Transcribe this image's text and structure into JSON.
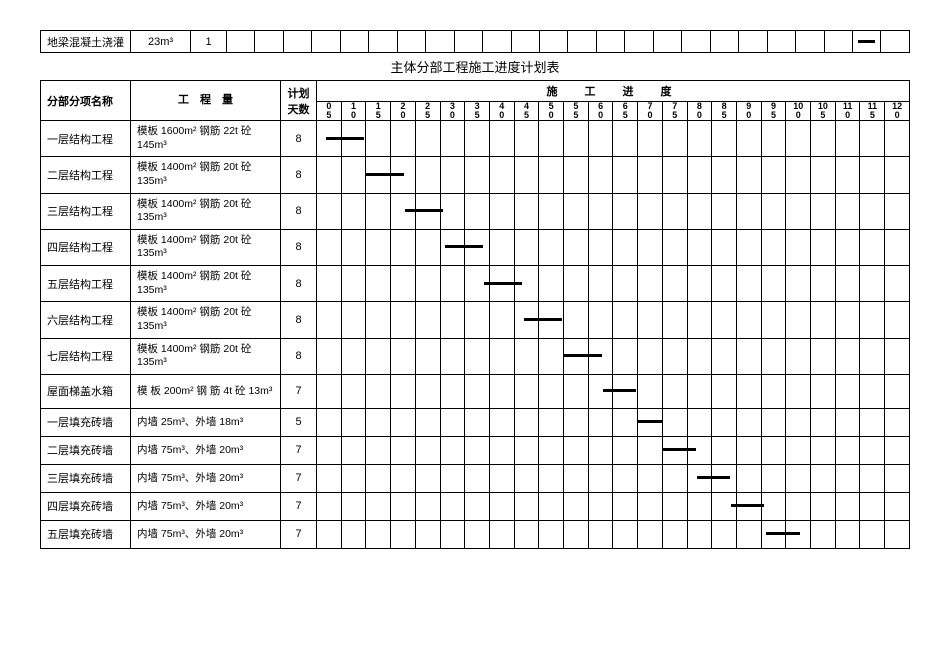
{
  "top_table": {
    "label": "地梁混凝土浇灌",
    "qty": "23m³",
    "days": "1",
    "bar_cell": 22
  },
  "caption": "主体分部工程施工进度计划表",
  "headers": {
    "name": "分部分项名称",
    "qty": "工　程　量",
    "days": "计划天数",
    "sched_group": "施　工　进　度"
  },
  "ticks": [
    "0 5",
    "1 0",
    "1 5",
    "2 0",
    "2 5",
    "3 0",
    "3 5",
    "4 0",
    "4 5",
    "5 0",
    "5 5",
    "6 0",
    "6 5",
    "7 0",
    "7 5",
    "8 0",
    "8 5",
    "9 0",
    "9 5",
    "10 0",
    "10 5",
    "11 0",
    "11 5",
    "12 0"
  ],
  "rows": [
    {
      "name": "一层结构工程",
      "qty": "模板 1600m² 钢筋 22t 砼 145m³",
      "days": "8",
      "tall": true
    },
    {
      "name": "二层结构工程",
      "qty": "模板 1400m² 钢筋 20t 砼 135m³",
      "days": "8",
      "tall": true
    },
    {
      "name": "三层结构工程",
      "qty": "模板 1400m² 钢筋 20t 砼 135m³",
      "days": "8",
      "tall": true
    },
    {
      "name": "四层结构工程",
      "qty": "模板 1400m² 钢筋 20t 砼 135m³",
      "days": "8",
      "tall": true
    },
    {
      "name": "五层结构工程",
      "qty": "模板 1400m² 钢筋 20t 砼 135m³",
      "days": "8",
      "tall": true
    },
    {
      "name": "六层结构工程",
      "qty": "模板 1400m² 钢筋 20t 砼 135m³",
      "days": "8",
      "tall": true
    },
    {
      "name": "七层结构工程",
      "qty": "模板 1400m² 钢筋 20t 砼 135m³",
      "days": "8",
      "tall": true
    },
    {
      "name": "屋面梯盖水箱",
      "qty": "模 板 200m² 钢 筋 4t 砼 13m³",
      "days": "7",
      "tall": true
    },
    {
      "name": "一层填充砖墙",
      "qty": "内墙 25m³、外墙 18m³",
      "days": "5",
      "tall": false
    },
    {
      "name": "二层填充砖墙",
      "qty": "内墙 75m³、外墙 20m³",
      "days": "7",
      "tall": false
    },
    {
      "name": "三层填充砖墙",
      "qty": "内墙 75m³、外墙 20m³",
      "days": "7",
      "tall": false
    },
    {
      "name": "四层填充砖墙",
      "qty": "内墙 75m³、外墙 20m³",
      "days": "7",
      "tall": false
    },
    {
      "name": "五层填充砖墙",
      "qty": "内墙 75m³、外墙 20m³",
      "days": "7",
      "tall": false
    }
  ],
  "chart_data": {
    "type": "bar",
    "title": "主体分部工程施工进度计划表 (Gantt)",
    "xlabel": "施工进度 (天)",
    "ylabel": "分部分项名称",
    "xlim": [
      0,
      120
    ],
    "series": [
      {
        "name": "一层结构工程",
        "start": 2,
        "end": 10,
        "duration": 8
      },
      {
        "name": "二层结构工程",
        "start": 10,
        "end": 18,
        "duration": 8
      },
      {
        "name": "三层结构工程",
        "start": 18,
        "end": 26,
        "duration": 8
      },
      {
        "name": "四层结构工程",
        "start": 26,
        "end": 34,
        "duration": 8
      },
      {
        "name": "五层结构工程",
        "start": 34,
        "end": 42,
        "duration": 8
      },
      {
        "name": "六层结构工程",
        "start": 42,
        "end": 50,
        "duration": 8
      },
      {
        "name": "七层结构工程",
        "start": 50,
        "end": 58,
        "duration": 8
      },
      {
        "name": "屋面梯盖水箱",
        "start": 58,
        "end": 65,
        "duration": 7
      },
      {
        "name": "一层填充砖墙",
        "start": 65,
        "end": 70,
        "duration": 5
      },
      {
        "name": "二层填充砖墙",
        "start": 70,
        "end": 77,
        "duration": 7
      },
      {
        "name": "三层填充砖墙",
        "start": 77,
        "end": 84,
        "duration": 7
      },
      {
        "name": "四层填充砖墙",
        "start": 84,
        "end": 91,
        "duration": 7
      },
      {
        "name": "五层填充砖墙",
        "start": 91,
        "end": 98,
        "duration": 7
      }
    ],
    "top_extra": {
      "name": "地梁混凝土浇灌",
      "duration": 1
    }
  }
}
